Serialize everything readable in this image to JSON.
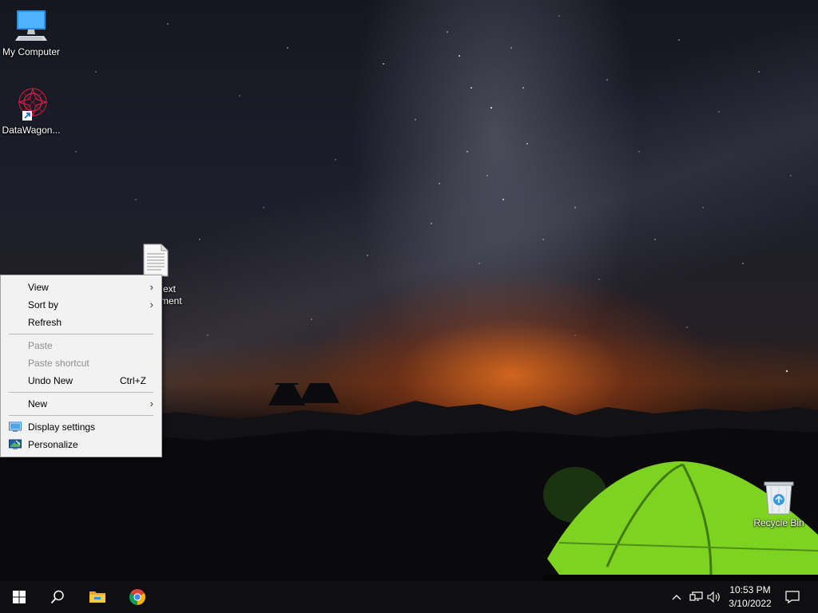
{
  "desktop": {
    "icons": [
      {
        "label": "My Computer",
        "icon": "monitor-icon"
      },
      {
        "label": "DataWagon...",
        "icon": "datawagon-shortcut-icon"
      },
      {
        "label": "Recycle Bin",
        "icon": "recycle-bin-icon"
      }
    ],
    "partial_file_label_line1": "ext",
    "partial_file_label_line2": "ment",
    "partial_file_icon": "text-document-icon"
  },
  "context_menu": {
    "items": [
      {
        "label": "View",
        "submenu": true
      },
      {
        "label": "Sort by",
        "submenu": true
      },
      {
        "label": "Refresh"
      },
      {
        "label": "Paste",
        "disabled": true
      },
      {
        "label": "Paste shortcut",
        "disabled": true
      },
      {
        "label": "Undo New",
        "shortcut": "Ctrl+Z"
      },
      {
        "label": "New",
        "submenu": true
      },
      {
        "label": "Display settings",
        "icon": "display-settings-icon"
      },
      {
        "label": "Personalize",
        "icon": "personalize-icon"
      }
    ]
  },
  "taskbar": {
    "buttons": [
      "start-icon",
      "search-icon",
      "file-explorer-icon",
      "chrome-icon"
    ],
    "tray": [
      "chevron-up-icon",
      "network-icon",
      "volume-icon",
      "notification-icon"
    ],
    "clock": {
      "time": "10:53 PM",
      "date": "3/10/2022"
    }
  },
  "colors": {
    "taskbar_bg": "#0f0f12",
    "menu_bg": "#f2f2f2",
    "tent_green": "#7ed321",
    "accent_blue": "#1e90ff"
  }
}
